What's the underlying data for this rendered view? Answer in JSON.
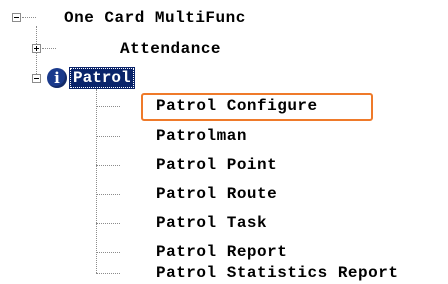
{
  "tree": {
    "root": {
      "label": "One Card MultiFunc",
      "expanded": true
    },
    "attendance": {
      "label": "Attendance",
      "expanded": false
    },
    "patrol": {
      "label": "Patrol",
      "expanded": true,
      "selected": true,
      "icon": "info-icon",
      "children": [
        {
          "label": "Patrol Configure",
          "highlighted": true
        },
        {
          "label": "Patrolman"
        },
        {
          "label": "Patrol Point"
        },
        {
          "label": "Patrol Route"
        },
        {
          "label": "Patrol Task"
        },
        {
          "label": "Patrol Report"
        },
        {
          "label": "Patrol Statistics Report"
        }
      ]
    }
  },
  "colors": {
    "selection_background": "#0a246a",
    "highlight_border": "#ef7a2a",
    "info_icon": "#1a3a8c"
  }
}
